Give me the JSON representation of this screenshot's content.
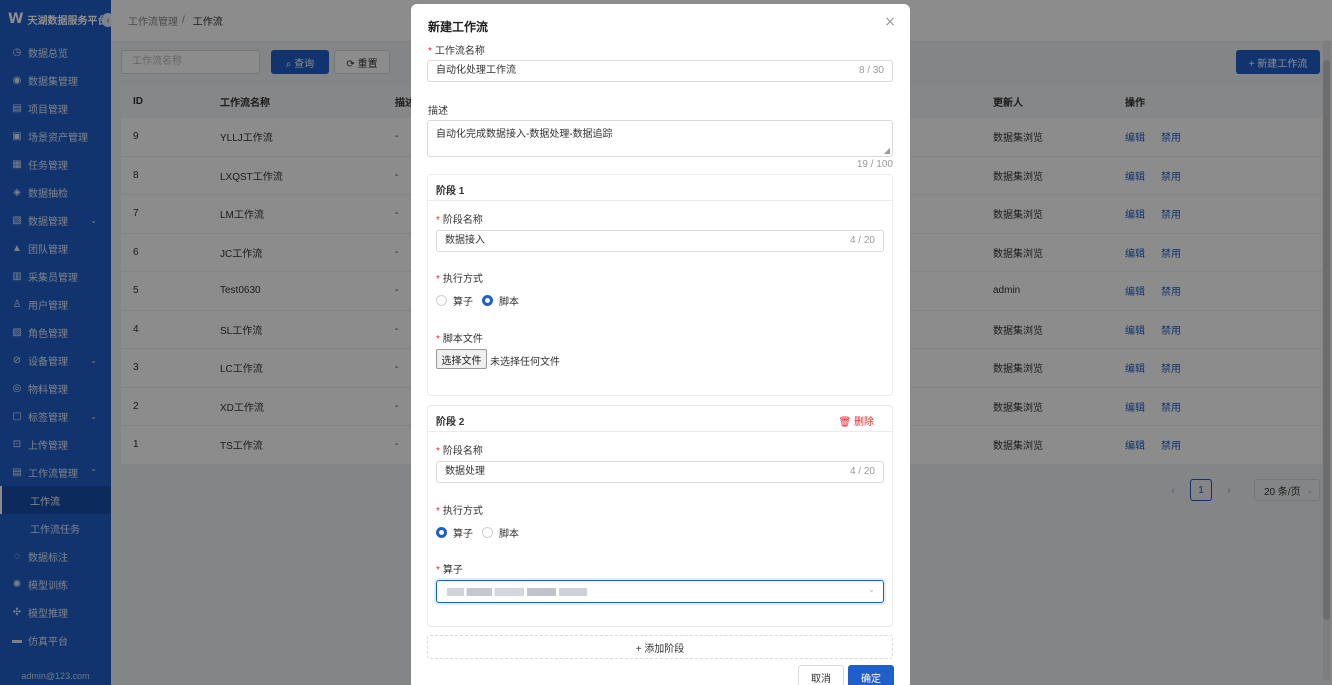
{
  "sidebar": {
    "logo_mark": "W",
    "app_title": "天湖数据服务平台",
    "collapse_icon": "‹",
    "items": [
      {
        "icon": "◷",
        "label": "数据总览"
      },
      {
        "icon": "◉",
        "label": "数据集管理"
      },
      {
        "icon": "▤",
        "label": "项目管理"
      },
      {
        "icon": "▣",
        "label": "场景资产管理"
      },
      {
        "icon": "▦",
        "label": "任务管理"
      },
      {
        "icon": "◈",
        "label": "数据抽检"
      },
      {
        "icon": "▧",
        "label": "数据管理",
        "chevron": "⌄"
      },
      {
        "icon": "▲",
        "label": "团队管理"
      },
      {
        "icon": "▥",
        "label": "采集员管理"
      },
      {
        "icon": "♙",
        "label": "用户管理"
      },
      {
        "icon": "▨",
        "label": "角色管理"
      },
      {
        "icon": "⊘",
        "label": "设备管理",
        "chevron": "⌄"
      },
      {
        "icon": "◎",
        "label": "物料管理"
      },
      {
        "icon": "▢",
        "label": "标签管理",
        "chevron": "⌄"
      },
      {
        "icon": "⊡",
        "label": "上传管理"
      },
      {
        "icon": "▤",
        "label": "工作流管理",
        "chevron": "⌃"
      }
    ],
    "sub_items": [
      {
        "label": "工作流",
        "active": true
      },
      {
        "label": "工作流任务",
        "active": false
      }
    ],
    "items_after": [
      {
        "icon": "◌",
        "label": "数据标注"
      },
      {
        "icon": "✺",
        "label": "模型训练"
      },
      {
        "icon": "✣",
        "label": "模型推理"
      },
      {
        "icon": "▬",
        "label": "仿真平台"
      }
    ],
    "user": "admin@123.com"
  },
  "breadcrumb": {
    "parent": "工作流管理",
    "sep": "/",
    "current": "工作流"
  },
  "toolbar": {
    "search_placeholder": "工作流名称",
    "query_label": "⌕ 查询",
    "reset_label": "⟳ 重置",
    "new_label": "+ 新建工作流"
  },
  "table": {
    "headers": {
      "id": "ID",
      "name": "工作流名称",
      "desc": "描述",
      "updater": "更新人",
      "ops": "操作"
    },
    "edit_label": "编辑",
    "disable_label": "禁用",
    "rows": [
      {
        "id": "9",
        "name": "YLLJ工作流",
        "desc": "-",
        "updater": "数据集浏览"
      },
      {
        "id": "8",
        "name": "LXQST工作流",
        "desc": "-",
        "updater": "数据集浏览"
      },
      {
        "id": "7",
        "name": "LM工作流",
        "desc": "-",
        "updater": "数据集浏览"
      },
      {
        "id": "6",
        "name": "JC工作流",
        "desc": "-",
        "updater": "数据集浏览"
      },
      {
        "id": "5",
        "name": "Test0630",
        "desc": "-",
        "updater": "admin"
      },
      {
        "id": "4",
        "name": "SL工作流",
        "desc": "-",
        "updater": "数据集浏览"
      },
      {
        "id": "3",
        "name": "LC工作流",
        "desc": "-",
        "updater": "数据集浏览"
      },
      {
        "id": "2",
        "name": "XD工作流",
        "desc": "-",
        "updater": "数据集浏览"
      },
      {
        "id": "1",
        "name": "TS工作流",
        "desc": "-",
        "updater": "数据集浏览"
      }
    ]
  },
  "pager": {
    "prev": "‹",
    "current": "1",
    "next": "›",
    "page_size": "20 条/页",
    "chevron": "⌄"
  },
  "modal": {
    "title": "新建工作流",
    "close": "×",
    "name_label": "工作流名称",
    "name_value": "自动化处理工作流",
    "name_count": "8 / 30",
    "desc_label": "描述",
    "desc_value": "自动化完成数据接入-数据处理-数据追踪",
    "desc_count": "19 / 100",
    "stage1": {
      "title": "阶段 1",
      "name_label": "阶段名称",
      "name_value": "数据接入",
      "name_count": "4 / 20",
      "mode_label": "执行方式",
      "opt_operator": "算子",
      "opt_script": "脚本",
      "selected": "script",
      "file_label": "脚本文件",
      "file_btn": "选择文件",
      "file_status": "未选择任何文件"
    },
    "stage2": {
      "title": "阶段 2",
      "delete_label": "删除",
      "name_label": "阶段名称",
      "name_value": "数据处理",
      "name_count": "4 / 20",
      "mode_label": "执行方式",
      "opt_operator": "算子",
      "opt_script": "脚本",
      "selected": "operator",
      "operator_label": "算子"
    },
    "add_stage_label": "+ 添加阶段",
    "cancel_label": "取消",
    "ok_label": "确定"
  },
  "colors": {
    "primary": "#1f5fc9",
    "danger": "#f5222d",
    "sidebar": "#1f5fc9"
  }
}
